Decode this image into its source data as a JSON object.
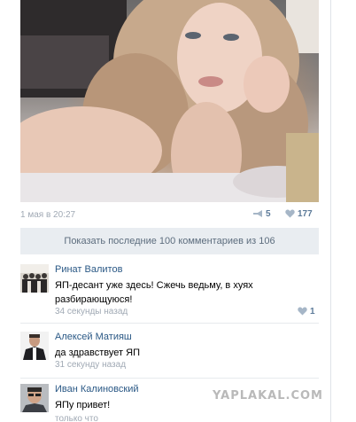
{
  "post": {
    "date": "1 мая в 20:27",
    "share_count": "5",
    "like_count": "177"
  },
  "show_more_label": "Показать последние 100 комментариев из 106",
  "comments": [
    {
      "author": "Ринат Валитов",
      "text": "ЯП-десант уже здесь! Сжечь ведьму, в хуях разбирающуюся!",
      "time": "34 секунды назад",
      "likes": "1"
    },
    {
      "author": "Алексей Матияш",
      "text": "да здравствует ЯП",
      "time": "31 секунду назад",
      "likes": ""
    },
    {
      "author": "Иван Калиновский",
      "text": "ЯПу привет!",
      "time": "только что",
      "likes": ""
    }
  ],
  "watermark": "YAPLAKAL.COM",
  "icons": {
    "share": "megaphone-icon",
    "like": "heart-icon"
  },
  "colors": {
    "link": "#2a5885",
    "meta": "#a0a9b4",
    "show_more_bg": "#e9edf1"
  }
}
